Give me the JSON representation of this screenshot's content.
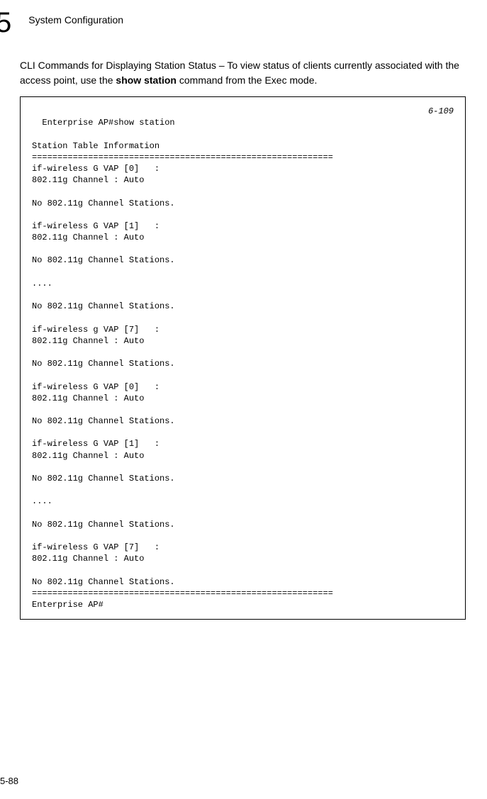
{
  "header": {
    "chapter_number": "5",
    "title": "System Configuration"
  },
  "intro": {
    "text_before": "CLI Commands for Displaying Station Status – To view status of clients currently associated with the access point, use the ",
    "command": "show station",
    "text_after": " command from the Exec mode."
  },
  "code": {
    "ref": "6-109",
    "body": "Enterprise AP#show station\n\nStation Table Information\n===========================================================\nif-wireless G VAP [0]   :\n802.11g Channel : Auto\n\nNo 802.11g Channel Stations.\n\nif-wireless G VAP [1]   :\n802.11g Channel : Auto\n\nNo 802.11g Channel Stations.\n\n....\n\nNo 802.11g Channel Stations.\n\nif-wireless g VAP [7]   :\n802.11g Channel : Auto\n\nNo 802.11g Channel Stations.\n\nif-wireless G VAP [0]   :\n802.11g Channel : Auto\n\nNo 802.11g Channel Stations.\n\nif-wireless G VAP [1]   :\n802.11g Channel : Auto\n\nNo 802.11g Channel Stations.\n\n....\n\nNo 802.11g Channel Stations.\n\nif-wireless G VAP [7]   :\n802.11g Channel : Auto\n\nNo 802.11g Channel Stations.\n===========================================================\nEnterprise AP#"
  },
  "footer": {
    "page_number": "5-88"
  },
  "chart_data": null
}
